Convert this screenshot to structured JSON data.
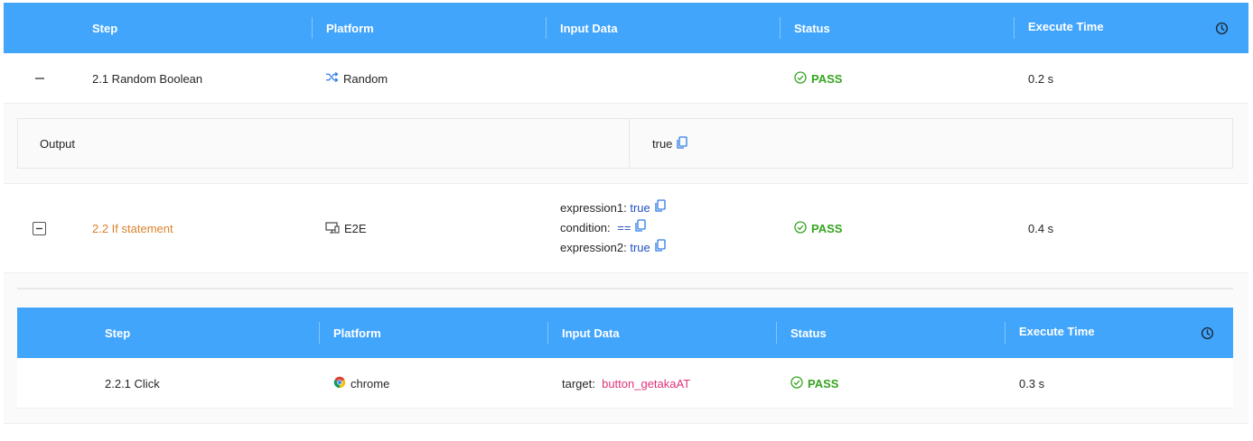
{
  "columns": {
    "step": "Step",
    "platform": "Platform",
    "input": "Input Data",
    "status": "Status",
    "time": "Execute Time"
  },
  "rows": [
    {
      "step": "2.1 Random Boolean",
      "platform": "Random",
      "platform_icon": "shuffle-icon",
      "status": "PASS",
      "time": "0.2 s",
      "output_label": "Output",
      "output_value": "true"
    },
    {
      "step": "2.2 If statement",
      "platform": "E2E",
      "platform_icon": "monitor-icon",
      "inputs": [
        {
          "key": "expression1:",
          "value": "true"
        },
        {
          "key": "condition:",
          "value": "=="
        },
        {
          "key": "expression2:",
          "value": "true"
        }
      ],
      "status": "PASS",
      "time": "0.4 s"
    }
  ],
  "nested": {
    "columns": {
      "step": "Step",
      "platform": "Platform",
      "input": "Input Data",
      "status": "Status",
      "time": "Execute Time"
    },
    "rows": [
      {
        "step": "2.2.1 Click",
        "platform": "chrome",
        "platform_icon": "chrome-icon",
        "input_key": "target:",
        "input_value": "button_getakaAT",
        "status": "PASS",
        "time": "0.3 s"
      }
    ]
  },
  "colors": {
    "header": "#42a5fc",
    "pass": "#36a420",
    "link": "#1e4fbf",
    "target": "#e0337a",
    "active_step": "#d9822b"
  }
}
